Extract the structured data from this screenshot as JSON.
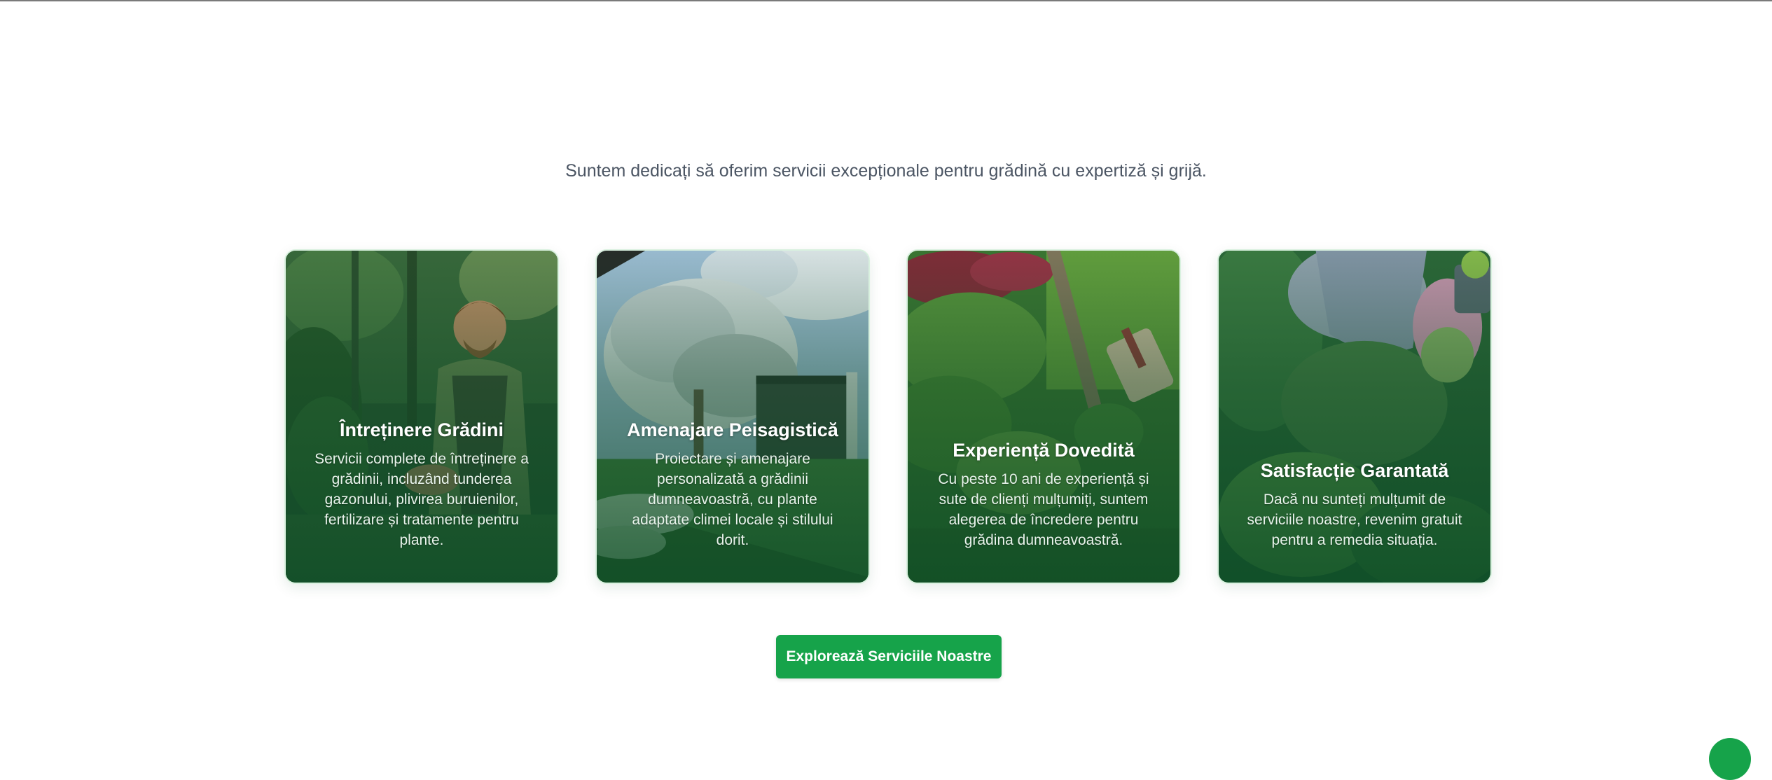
{
  "intro": {
    "text": "Suntem dedicați să oferim servicii excepționale pentru grădină cu expertiză și grijă."
  },
  "cards": [
    {
      "title": "Întreținere Grădini",
      "description": "Servicii complete de întreținere a grădinii, incluzând tunderea gazonului, plivirea buruienilor, fertilizare și tratamente pentru plante."
    },
    {
      "title": "Amenajare Peisagistică",
      "description": "Proiectare și amenajare personalizată a grădinii dumneavoastră, cu plante adaptate climei locale și stilului dorit."
    },
    {
      "title": "Experiență Dovedită",
      "description": "Cu peste 10 ani de experiență și sute de clienți mulțumiți, suntem alegerea de încredere pentru grădina dumneavoastră."
    },
    {
      "title": "Satisfacție Garantată",
      "description": "Dacă nu sunteți mulțumit de serviciile noastre, revenim gratuit pentru a remedia situația."
    }
  ],
  "cta": {
    "label": "Explorează Serviciile Noastre"
  },
  "colors": {
    "accent": "#16a34a",
    "card_overlay": "#0a4623",
    "text_muted": "#4b5563"
  }
}
